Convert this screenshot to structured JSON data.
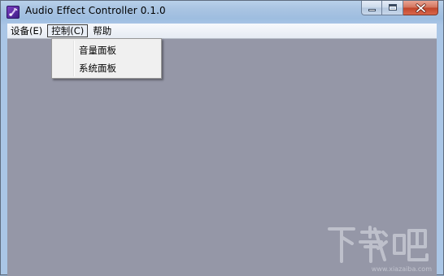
{
  "window": {
    "title": "Audio Effect Controller 0.1.0",
    "icons": {
      "app": "app-icon",
      "minimize": "minimize-icon",
      "maximize": "maximize-icon",
      "close": "close-icon"
    }
  },
  "menubar": {
    "items": [
      {
        "label": "设备(E)"
      },
      {
        "label": "控制(C)",
        "active": true
      },
      {
        "label": "帮助"
      }
    ]
  },
  "dropdown": {
    "items": [
      {
        "label": "音量面板"
      },
      {
        "label": "系统面板"
      }
    ]
  },
  "watermark": {
    "text": "下载吧",
    "url": "www.xiazaiba.com"
  },
  "colors": {
    "client_bg": "#9597a7",
    "close_button": "#c0442a",
    "titlebar": "#a9c4e2"
  }
}
